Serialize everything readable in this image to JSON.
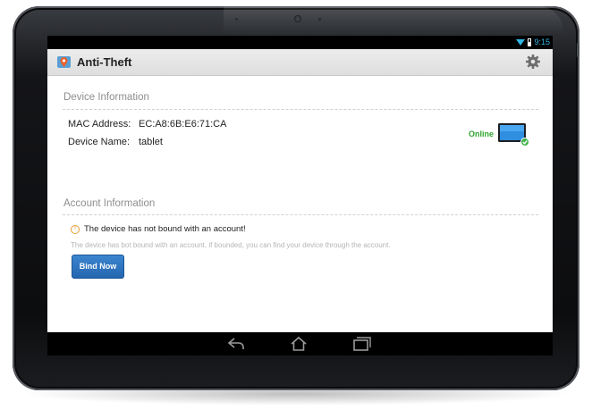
{
  "statusbar": {
    "time": "9:15"
  },
  "actionbar": {
    "title": "Anti-Theft"
  },
  "device_info": {
    "header": "Device Information",
    "mac_label": "MAC Address:",
    "mac_value": "EC:A8:6B:E6:71:CA",
    "name_label": "Device Name:",
    "name_value": "tablet",
    "status": "Online"
  },
  "account_info": {
    "header": "Account Information",
    "warning": "The device has not bound with an account!",
    "note": "The device has bot bound with an account, if bounded, you can find your device through the account.",
    "bind_button": "Bind Now"
  },
  "colors": {
    "accent": "#33b5e5",
    "online": "#2fa52f",
    "button": "#2c72bd",
    "warning": "#e8a033"
  },
  "icons": [
    "wifi-icon",
    "battery-icon",
    "app-icon",
    "settings-icon",
    "warning-icon",
    "tablet-online-icon",
    "back-icon",
    "home-icon",
    "recent-apps-icon"
  ]
}
